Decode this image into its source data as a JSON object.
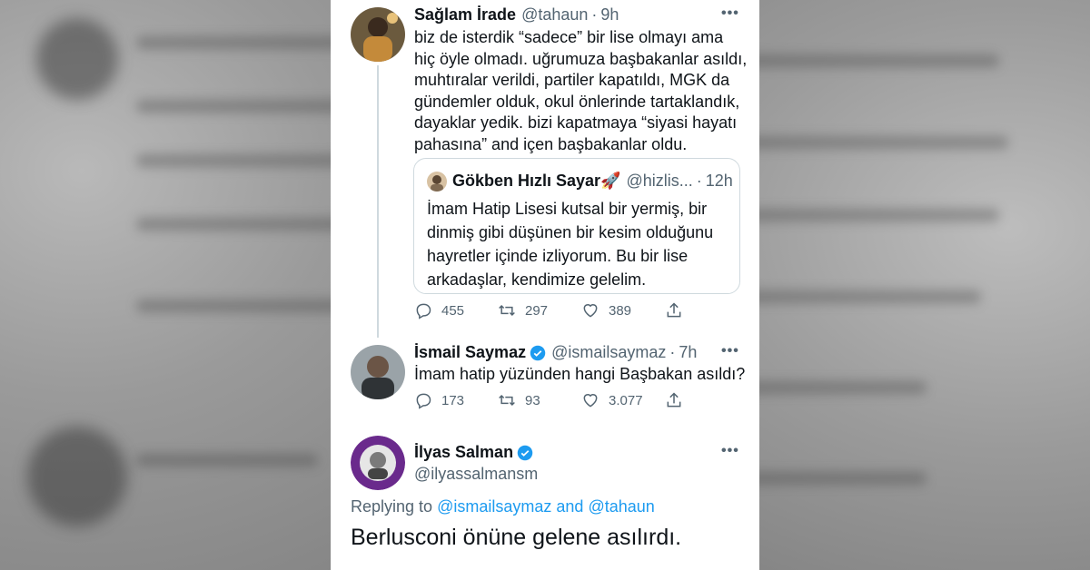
{
  "colors": {
    "text": "#0f1419",
    "secondary": "#536471",
    "link": "#1d9bf0",
    "border": "#cfd9de",
    "verified": "#1d9bf0"
  },
  "tweet1": {
    "name": "Sağlam İrade",
    "handle": "@tahaun",
    "time": "9h",
    "lines": [
      "biz de isterdik “sadece” bir lise olmayı ama",
      "hiç öyle olmadı. uğrumuza başbakanlar asıldı,",
      "muhtıralar verildi, partiler kapatıldı, MGK da",
      "gündemler olduk, okul önlerinde tartaklandık,",
      "dayaklar yedik. bizi kapatmaya “siyasi hayatı",
      "pahasına” and içen başbakanlar oldu."
    ],
    "quote": {
      "name": "Gökben Hızlı Sayar🚀",
      "handle": "@hizlis...",
      "time": "12h",
      "lines": [
        "İmam Hatip Lisesi kutsal bir yermiş, bir",
        "dinmiş gibi düşünen bir kesim olduğunu",
        "hayretler içinde izliyorum. Bu bir lise",
        "arkadaşlar, kendimize gelelim."
      ]
    },
    "replies": "455",
    "retweets": "297",
    "likes": "389"
  },
  "tweet2": {
    "name": "İsmail Saymaz",
    "handle": "@ismailsaymaz",
    "time": "7h",
    "text": "İmam hatip yüzünden hangi Başbakan asıldı?",
    "replies": "173",
    "retweets": "93",
    "likes": "3.077"
  },
  "tweet3": {
    "name": "İlyas Salman",
    "handle": "@ilyassalmansm",
    "replying_prefix": "Replying to",
    "replying_mention1": "@ismailsaymaz",
    "replying_and": "and",
    "replying_mention2": "@tahaun",
    "text": "Berlusconi önüne gelene asılırdı."
  },
  "icons": {
    "more": "more-icon",
    "reply": "reply-icon",
    "retweet": "retweet-icon",
    "like": "heart-icon",
    "share": "share-icon",
    "verified": "verified-badge-icon"
  },
  "more_glyph": "•••"
}
